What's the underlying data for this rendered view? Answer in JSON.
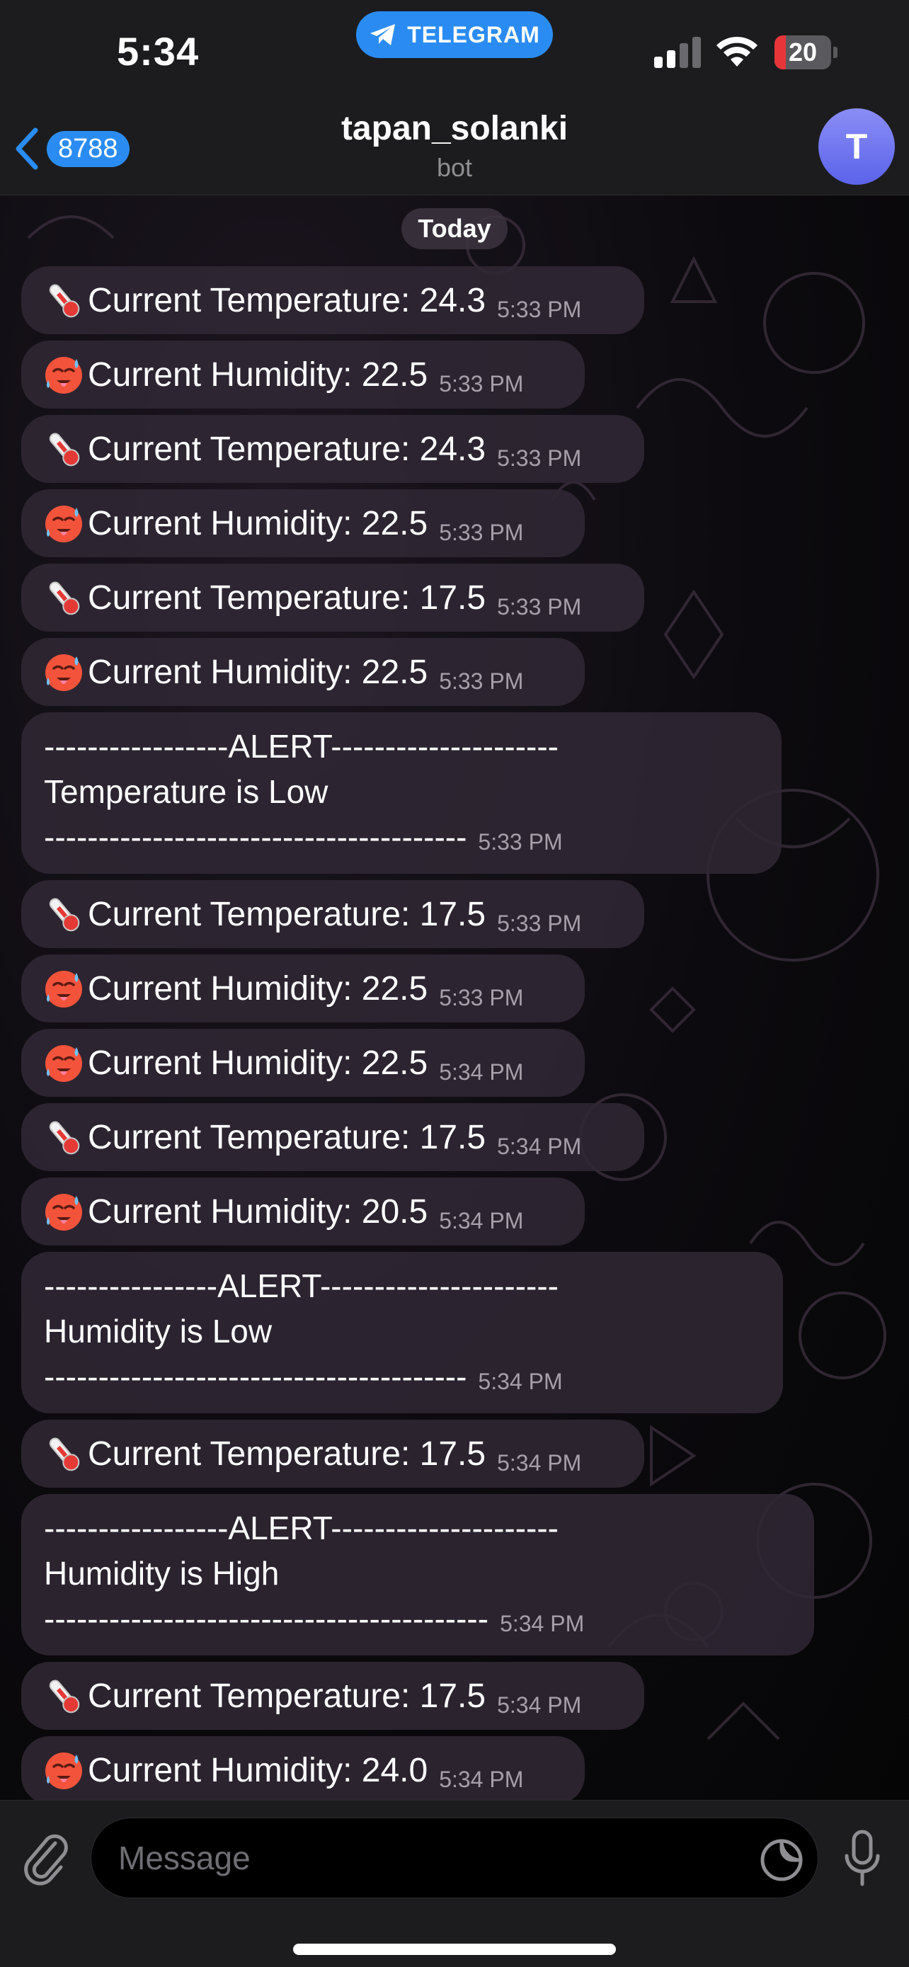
{
  "status_bar": {
    "time": "5:34",
    "pill_label": "TELEGRAM",
    "battery_level": 20,
    "battery_label": "20",
    "battery_color": "#e8353a"
  },
  "header": {
    "back_count": "8788",
    "title": "tapan_solanki",
    "subtitle": "bot",
    "avatar_initial": "T",
    "accent_color": "#2a8cf3"
  },
  "date_chip": "Today",
  "messages": [
    {
      "kind": "temp",
      "icon": "thermometer-icon",
      "text": "Current Temperature: 24.3",
      "time": "5:33 PM"
    },
    {
      "kind": "humid",
      "icon": "hot-face-icon",
      "text": "Current Humidity: 22.5",
      "time": "5:33 PM"
    },
    {
      "kind": "temp",
      "icon": "thermometer-icon",
      "text": "Current Temperature: 24.3",
      "time": "5:33 PM"
    },
    {
      "kind": "humid",
      "icon": "hot-face-icon",
      "text": "Current Humidity: 22.5",
      "time": "5:33 PM"
    },
    {
      "kind": "temp",
      "icon": "thermometer-icon",
      "text": "Current Temperature: 17.5",
      "time": "5:33 PM"
    },
    {
      "kind": "humid",
      "icon": "hot-face-icon",
      "text": "Current Humidity: 22.5",
      "time": "5:33 PM"
    },
    {
      "kind": "alert",
      "line1": "-----------------ALERT---------------------",
      "line2": "Temperature is Low",
      "line3": "---------------------------------------",
      "time": "5:33 PM"
    },
    {
      "kind": "temp",
      "icon": "thermometer-icon",
      "text": "Current Temperature: 17.5",
      "time": "5:33 PM"
    },
    {
      "kind": "humid",
      "icon": "hot-face-icon",
      "text": "Current Humidity: 22.5",
      "time": "5:33 PM"
    },
    {
      "kind": "humid",
      "icon": "hot-face-icon",
      "text": "Current Humidity: 22.5",
      "time": "5:34 PM"
    },
    {
      "kind": "temp",
      "icon": "thermometer-icon",
      "text": "Current Temperature: 17.5",
      "time": "5:34 PM"
    },
    {
      "kind": "humid",
      "icon": "hot-face-icon",
      "text": "Current Humidity: 20.5",
      "time": "5:34 PM"
    },
    {
      "kind": "alert",
      "line1": "----------------ALERT----------------------",
      "line2": "Humidity is Low",
      "line3": "---------------------------------------",
      "time": "5:34 PM"
    },
    {
      "kind": "temp",
      "icon": "thermometer-icon",
      "text": "Current Temperature: 17.5",
      "time": "5:34 PM"
    },
    {
      "kind": "alert",
      "line1": "-----------------ALERT---------------------",
      "line2": "Humidity is High",
      "line3": "-----------------------------------------",
      "time": "5:34 PM"
    },
    {
      "kind": "temp",
      "icon": "thermometer-icon",
      "text": "Current Temperature: 17.5",
      "time": "5:34 PM"
    },
    {
      "kind": "humid",
      "icon": "hot-face-icon",
      "text": "Current Humidity: 24.0",
      "time": "5:34 PM"
    }
  ],
  "composer": {
    "placeholder": "Message"
  }
}
